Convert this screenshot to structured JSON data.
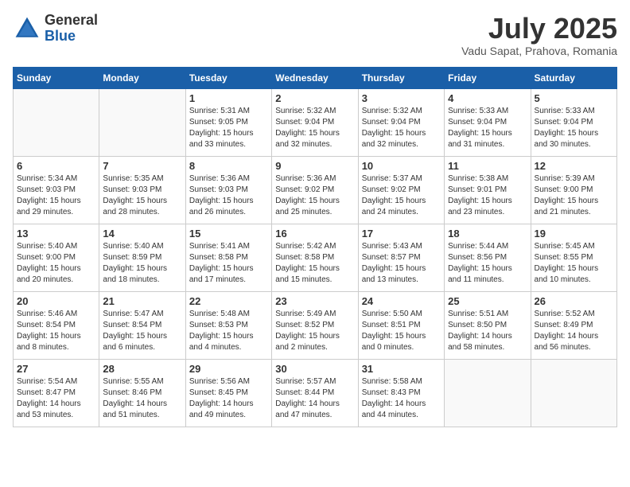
{
  "header": {
    "logo_general": "General",
    "logo_blue": "Blue",
    "month_title": "July 2025",
    "location": "Vadu Sapat, Prahova, Romania"
  },
  "weekdays": [
    "Sunday",
    "Monday",
    "Tuesday",
    "Wednesday",
    "Thursday",
    "Friday",
    "Saturday"
  ],
  "weeks": [
    [
      {
        "day": "",
        "info": ""
      },
      {
        "day": "",
        "info": ""
      },
      {
        "day": "1",
        "info": "Sunrise: 5:31 AM\nSunset: 9:05 PM\nDaylight: 15 hours and 33 minutes."
      },
      {
        "day": "2",
        "info": "Sunrise: 5:32 AM\nSunset: 9:04 PM\nDaylight: 15 hours and 32 minutes."
      },
      {
        "day": "3",
        "info": "Sunrise: 5:32 AM\nSunset: 9:04 PM\nDaylight: 15 hours and 32 minutes."
      },
      {
        "day": "4",
        "info": "Sunrise: 5:33 AM\nSunset: 9:04 PM\nDaylight: 15 hours and 31 minutes."
      },
      {
        "day": "5",
        "info": "Sunrise: 5:33 AM\nSunset: 9:04 PM\nDaylight: 15 hours and 30 minutes."
      }
    ],
    [
      {
        "day": "6",
        "info": "Sunrise: 5:34 AM\nSunset: 9:03 PM\nDaylight: 15 hours and 29 minutes."
      },
      {
        "day": "7",
        "info": "Sunrise: 5:35 AM\nSunset: 9:03 PM\nDaylight: 15 hours and 28 minutes."
      },
      {
        "day": "8",
        "info": "Sunrise: 5:36 AM\nSunset: 9:03 PM\nDaylight: 15 hours and 26 minutes."
      },
      {
        "day": "9",
        "info": "Sunrise: 5:36 AM\nSunset: 9:02 PM\nDaylight: 15 hours and 25 minutes."
      },
      {
        "day": "10",
        "info": "Sunrise: 5:37 AM\nSunset: 9:02 PM\nDaylight: 15 hours and 24 minutes."
      },
      {
        "day": "11",
        "info": "Sunrise: 5:38 AM\nSunset: 9:01 PM\nDaylight: 15 hours and 23 minutes."
      },
      {
        "day": "12",
        "info": "Sunrise: 5:39 AM\nSunset: 9:00 PM\nDaylight: 15 hours and 21 minutes."
      }
    ],
    [
      {
        "day": "13",
        "info": "Sunrise: 5:40 AM\nSunset: 9:00 PM\nDaylight: 15 hours and 20 minutes."
      },
      {
        "day": "14",
        "info": "Sunrise: 5:40 AM\nSunset: 8:59 PM\nDaylight: 15 hours and 18 minutes."
      },
      {
        "day": "15",
        "info": "Sunrise: 5:41 AM\nSunset: 8:58 PM\nDaylight: 15 hours and 17 minutes."
      },
      {
        "day": "16",
        "info": "Sunrise: 5:42 AM\nSunset: 8:58 PM\nDaylight: 15 hours and 15 minutes."
      },
      {
        "day": "17",
        "info": "Sunrise: 5:43 AM\nSunset: 8:57 PM\nDaylight: 15 hours and 13 minutes."
      },
      {
        "day": "18",
        "info": "Sunrise: 5:44 AM\nSunset: 8:56 PM\nDaylight: 15 hours and 11 minutes."
      },
      {
        "day": "19",
        "info": "Sunrise: 5:45 AM\nSunset: 8:55 PM\nDaylight: 15 hours and 10 minutes."
      }
    ],
    [
      {
        "day": "20",
        "info": "Sunrise: 5:46 AM\nSunset: 8:54 PM\nDaylight: 15 hours and 8 minutes."
      },
      {
        "day": "21",
        "info": "Sunrise: 5:47 AM\nSunset: 8:54 PM\nDaylight: 15 hours and 6 minutes."
      },
      {
        "day": "22",
        "info": "Sunrise: 5:48 AM\nSunset: 8:53 PM\nDaylight: 15 hours and 4 minutes."
      },
      {
        "day": "23",
        "info": "Sunrise: 5:49 AM\nSunset: 8:52 PM\nDaylight: 15 hours and 2 minutes."
      },
      {
        "day": "24",
        "info": "Sunrise: 5:50 AM\nSunset: 8:51 PM\nDaylight: 15 hours and 0 minutes."
      },
      {
        "day": "25",
        "info": "Sunrise: 5:51 AM\nSunset: 8:50 PM\nDaylight: 14 hours and 58 minutes."
      },
      {
        "day": "26",
        "info": "Sunrise: 5:52 AM\nSunset: 8:49 PM\nDaylight: 14 hours and 56 minutes."
      }
    ],
    [
      {
        "day": "27",
        "info": "Sunrise: 5:54 AM\nSunset: 8:47 PM\nDaylight: 14 hours and 53 minutes."
      },
      {
        "day": "28",
        "info": "Sunrise: 5:55 AM\nSunset: 8:46 PM\nDaylight: 14 hours and 51 minutes."
      },
      {
        "day": "29",
        "info": "Sunrise: 5:56 AM\nSunset: 8:45 PM\nDaylight: 14 hours and 49 minutes."
      },
      {
        "day": "30",
        "info": "Sunrise: 5:57 AM\nSunset: 8:44 PM\nDaylight: 14 hours and 47 minutes."
      },
      {
        "day": "31",
        "info": "Sunrise: 5:58 AM\nSunset: 8:43 PM\nDaylight: 14 hours and 44 minutes."
      },
      {
        "day": "",
        "info": ""
      },
      {
        "day": "",
        "info": ""
      }
    ]
  ]
}
